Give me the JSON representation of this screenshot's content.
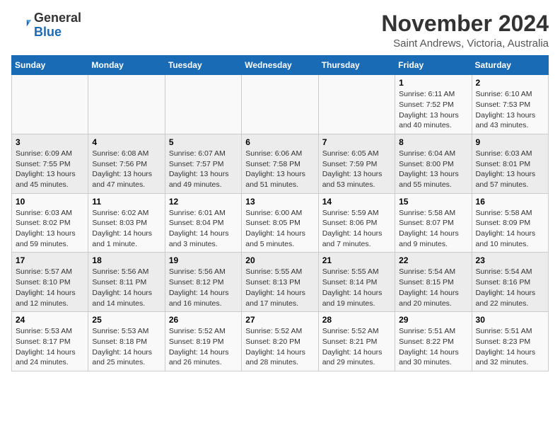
{
  "header": {
    "logo_line1": "General",
    "logo_line2": "Blue",
    "title": "November 2024",
    "subtitle": "Saint Andrews, Victoria, Australia"
  },
  "calendar": {
    "days_of_week": [
      "Sunday",
      "Monday",
      "Tuesday",
      "Wednesday",
      "Thursday",
      "Friday",
      "Saturday"
    ],
    "weeks": [
      [
        {
          "day": "",
          "info": ""
        },
        {
          "day": "",
          "info": ""
        },
        {
          "day": "",
          "info": ""
        },
        {
          "day": "",
          "info": ""
        },
        {
          "day": "",
          "info": ""
        },
        {
          "day": "1",
          "info": "Sunrise: 6:11 AM\nSunset: 7:52 PM\nDaylight: 13 hours\nand 40 minutes."
        },
        {
          "day": "2",
          "info": "Sunrise: 6:10 AM\nSunset: 7:53 PM\nDaylight: 13 hours\nand 43 minutes."
        }
      ],
      [
        {
          "day": "3",
          "info": "Sunrise: 6:09 AM\nSunset: 7:55 PM\nDaylight: 13 hours\nand 45 minutes."
        },
        {
          "day": "4",
          "info": "Sunrise: 6:08 AM\nSunset: 7:56 PM\nDaylight: 13 hours\nand 47 minutes."
        },
        {
          "day": "5",
          "info": "Sunrise: 6:07 AM\nSunset: 7:57 PM\nDaylight: 13 hours\nand 49 minutes."
        },
        {
          "day": "6",
          "info": "Sunrise: 6:06 AM\nSunset: 7:58 PM\nDaylight: 13 hours\nand 51 minutes."
        },
        {
          "day": "7",
          "info": "Sunrise: 6:05 AM\nSunset: 7:59 PM\nDaylight: 13 hours\nand 53 minutes."
        },
        {
          "day": "8",
          "info": "Sunrise: 6:04 AM\nSunset: 8:00 PM\nDaylight: 13 hours\nand 55 minutes."
        },
        {
          "day": "9",
          "info": "Sunrise: 6:03 AM\nSunset: 8:01 PM\nDaylight: 13 hours\nand 57 minutes."
        }
      ],
      [
        {
          "day": "10",
          "info": "Sunrise: 6:03 AM\nSunset: 8:02 PM\nDaylight: 13 hours\nand 59 minutes."
        },
        {
          "day": "11",
          "info": "Sunrise: 6:02 AM\nSunset: 8:03 PM\nDaylight: 14 hours\nand 1 minute."
        },
        {
          "day": "12",
          "info": "Sunrise: 6:01 AM\nSunset: 8:04 PM\nDaylight: 14 hours\nand 3 minutes."
        },
        {
          "day": "13",
          "info": "Sunrise: 6:00 AM\nSunset: 8:05 PM\nDaylight: 14 hours\nand 5 minutes."
        },
        {
          "day": "14",
          "info": "Sunrise: 5:59 AM\nSunset: 8:06 PM\nDaylight: 14 hours\nand 7 minutes."
        },
        {
          "day": "15",
          "info": "Sunrise: 5:58 AM\nSunset: 8:07 PM\nDaylight: 14 hours\nand 9 minutes."
        },
        {
          "day": "16",
          "info": "Sunrise: 5:58 AM\nSunset: 8:09 PM\nDaylight: 14 hours\nand 10 minutes."
        }
      ],
      [
        {
          "day": "17",
          "info": "Sunrise: 5:57 AM\nSunset: 8:10 PM\nDaylight: 14 hours\nand 12 minutes."
        },
        {
          "day": "18",
          "info": "Sunrise: 5:56 AM\nSunset: 8:11 PM\nDaylight: 14 hours\nand 14 minutes."
        },
        {
          "day": "19",
          "info": "Sunrise: 5:56 AM\nSunset: 8:12 PM\nDaylight: 14 hours\nand 16 minutes."
        },
        {
          "day": "20",
          "info": "Sunrise: 5:55 AM\nSunset: 8:13 PM\nDaylight: 14 hours\nand 17 minutes."
        },
        {
          "day": "21",
          "info": "Sunrise: 5:55 AM\nSunset: 8:14 PM\nDaylight: 14 hours\nand 19 minutes."
        },
        {
          "day": "22",
          "info": "Sunrise: 5:54 AM\nSunset: 8:15 PM\nDaylight: 14 hours\nand 20 minutes."
        },
        {
          "day": "23",
          "info": "Sunrise: 5:54 AM\nSunset: 8:16 PM\nDaylight: 14 hours\nand 22 minutes."
        }
      ],
      [
        {
          "day": "24",
          "info": "Sunrise: 5:53 AM\nSunset: 8:17 PM\nDaylight: 14 hours\nand 24 minutes."
        },
        {
          "day": "25",
          "info": "Sunrise: 5:53 AM\nSunset: 8:18 PM\nDaylight: 14 hours\nand 25 minutes."
        },
        {
          "day": "26",
          "info": "Sunrise: 5:52 AM\nSunset: 8:19 PM\nDaylight: 14 hours\nand 26 minutes."
        },
        {
          "day": "27",
          "info": "Sunrise: 5:52 AM\nSunset: 8:20 PM\nDaylight: 14 hours\nand 28 minutes."
        },
        {
          "day": "28",
          "info": "Sunrise: 5:52 AM\nSunset: 8:21 PM\nDaylight: 14 hours\nand 29 minutes."
        },
        {
          "day": "29",
          "info": "Sunrise: 5:51 AM\nSunset: 8:22 PM\nDaylight: 14 hours\nand 30 minutes."
        },
        {
          "day": "30",
          "info": "Sunrise: 5:51 AM\nSunset: 8:23 PM\nDaylight: 14 hours\nand 32 minutes."
        }
      ]
    ]
  }
}
